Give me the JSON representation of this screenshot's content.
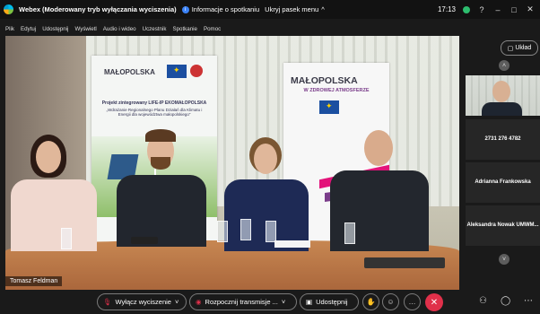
{
  "titlebar": {
    "app_name": "Webex",
    "mode": "(Moderowany tryb wyłączania wyciszenia)",
    "info": "Informacje o spotkaniu",
    "hide_menu": "Ukryj pasek menu",
    "time": "17:13"
  },
  "menu": [
    "Plik",
    "Edytuj",
    "Udostępnij",
    "Wyświetl",
    "Audio i wideo",
    "Uczestnik",
    "Spotkanie",
    "Pomoc"
  ],
  "layout_label": "Układ",
  "banner1": {
    "brand": "MAŁOPOLSKA",
    "small1": "Projekt zintegrowany LIFE-IP EKOMAŁOPOLSKA",
    "small2": "„Wdrażanie Regionalnego Planu Działań dla Klimatu i Energii dla województwa małopolskiego”"
  },
  "banner2": {
    "brand": "MAŁOPOLSKA",
    "tagline": "W ZDROWEJ ATMOSFERZE"
  },
  "speaker_name": "Tomasz Feldman",
  "participants": [
    {
      "label": ""
    },
    {
      "label": "2731 276 4782"
    },
    {
      "label": "Adrianna Frankowska"
    },
    {
      "label": "Aleksandra Nowak UMWM..."
    }
  ],
  "controls": {
    "mute": "Wyłącz wyciszenie",
    "record": "Rozpocznij transmisje ...",
    "share": "Udostępnij"
  },
  "colors": {
    "end_call": "#e0304a",
    "accent": "#00bceb"
  },
  "icons": [
    "webex-logo-icon",
    "info-icon",
    "chevron-up-icon",
    "minimize-icon",
    "maximize-icon",
    "close-icon",
    "layout-icon",
    "mic-off-icon",
    "broadcast-icon",
    "share-icon",
    "hand-icon",
    "reaction-icon",
    "more-icon",
    "end-call-icon",
    "participants-icon",
    "chat-icon"
  ]
}
